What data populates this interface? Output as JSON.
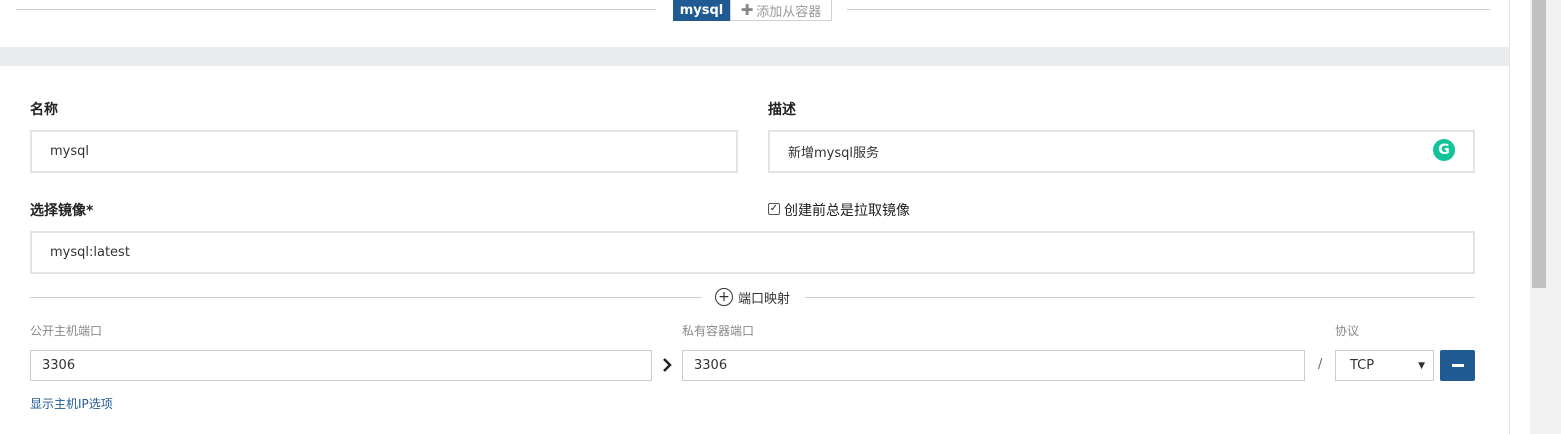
{
  "tabs": {
    "active_label": "mysql",
    "add_label": "添加从容器"
  },
  "form": {
    "name_label": "名称",
    "name_value": "mysql",
    "desc_label": "描述",
    "desc_value": "新增mysql服务",
    "image_label": "选择镜像*",
    "pull_label": "创建前总是拉取镜像",
    "pull_checked": true,
    "image_value": "mysql:latest"
  },
  "ports": {
    "section_label": "端口映射",
    "public_label": "公开主机端口",
    "private_label": "私有容器端口",
    "protocol_label": "协议",
    "public_value": "3306",
    "private_value": "3306",
    "separator": "/",
    "protocol_value": "TCP",
    "show_ip_link": "显示主机IP选项"
  },
  "icons": {
    "add": "plus-icon",
    "grammarly": "grammarly-icon",
    "port_add": "circle-plus-icon",
    "arrow": "chevron-right-icon",
    "dropdown": "caret-down-icon",
    "remove": "minus-icon"
  },
  "colors": {
    "accent": "#1f5a93",
    "grammarly": "#15c39a",
    "band": "#e9ecec"
  }
}
